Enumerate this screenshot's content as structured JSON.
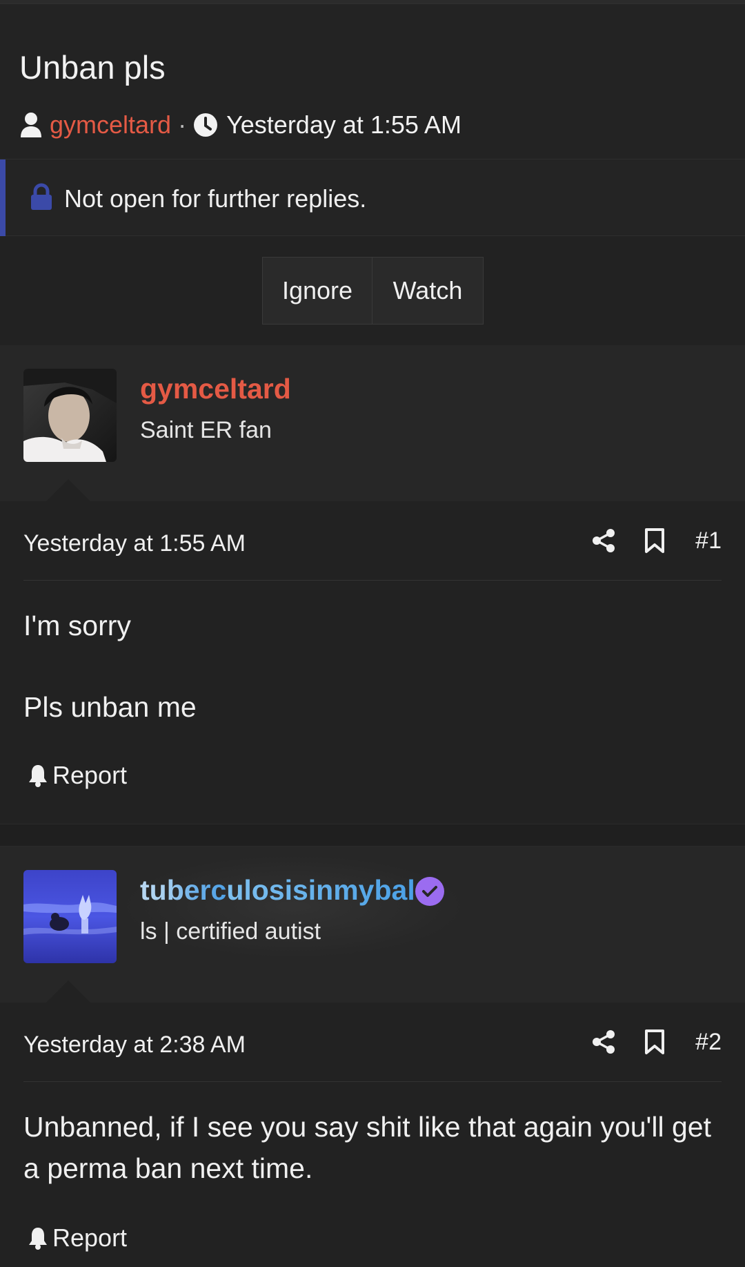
{
  "thread": {
    "title": "Unban pls",
    "author": "gymceltard",
    "separator": "·",
    "date": "Yesterday at 1:55 AM"
  },
  "notice": {
    "text": "Not open for further replies."
  },
  "actions": {
    "ignore_label": "Ignore",
    "watch_label": "Watch"
  },
  "posts": [
    {
      "username": "gymceltard",
      "user_title": "Saint ER fan",
      "date": "Yesterday at 1:55 AM",
      "number": "#1",
      "lines": [
        "I'm sorry",
        "Pls unban me"
      ],
      "report_label": "Report",
      "name_color": "#e45a45"
    },
    {
      "username_part1": "tuberc",
      "username_part2": "ulosisinmybal",
      "user_title": "ls | certified autist",
      "date": "Yesterday at 2:38 AM",
      "number": "#2",
      "lines": [
        "Unbanned, if I see you say shit like that again you'll get a perma ban next time."
      ],
      "report_label": "Report",
      "verified": true,
      "verified_color": "#9b6cf0"
    }
  ],
  "icons": {
    "user": "user-icon",
    "clock": "clock-icon",
    "lock": "lock-icon",
    "share": "share-icon",
    "bookmark": "bookmark-icon",
    "bell": "bell-icon",
    "verified": "verified-check-icon"
  },
  "colors": {
    "accent_author": "#e45a45",
    "notice_bar": "#3b4aa8",
    "background": "#1d1d1d"
  }
}
